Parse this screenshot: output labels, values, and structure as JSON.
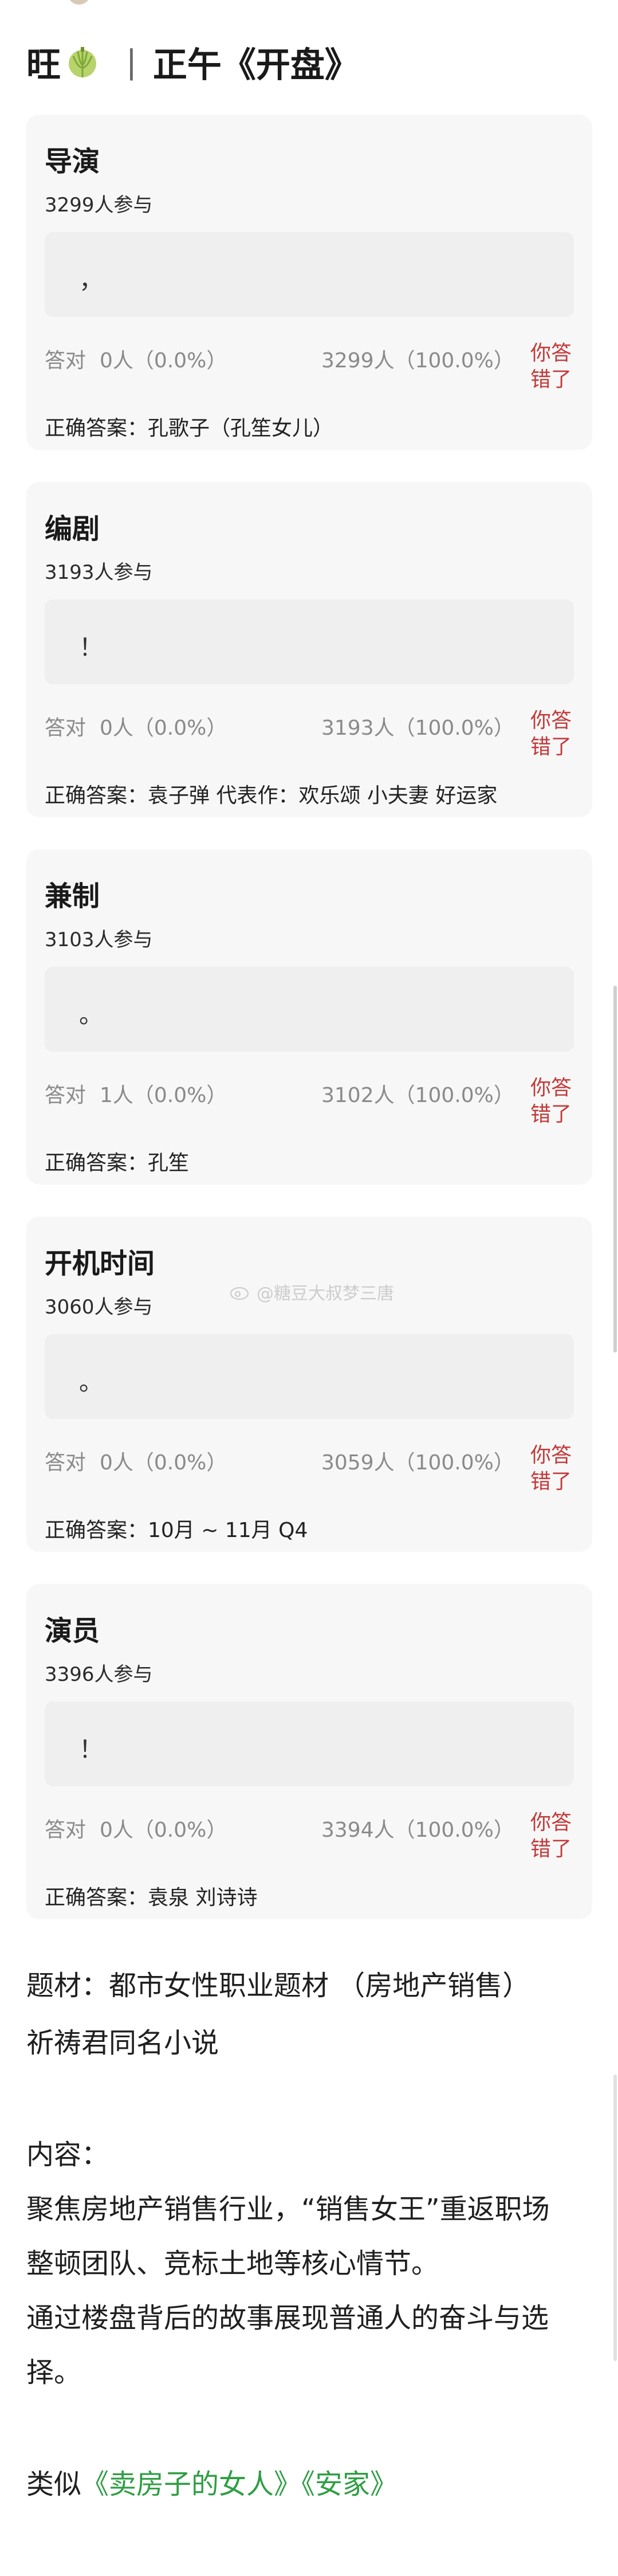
{
  "header": {
    "left": "旺",
    "separator": "|",
    "title": "正午《开盘》"
  },
  "questions": [
    {
      "title": "导演",
      "participants": "3299人参与",
      "answer": "，",
      "stat_label": "答对",
      "correct_count": "0人（0.0%）",
      "wrong_count": "3299人（100.0%）",
      "result": "你答错了",
      "correct_answer": "正确答案：孔歌子（孔笙女儿）"
    },
    {
      "title": "编剧",
      "participants": "3193人参与",
      "answer": "！",
      "stat_label": "答对",
      "correct_count": "0人（0.0%）",
      "wrong_count": "3193人（100.0%）",
      "result": "你答错了",
      "correct_answer": "正确答案：袁子弹 代表作：欢乐颂 小夫妻 好运家"
    },
    {
      "title": "兼制",
      "participants": "3103人参与",
      "answer": "。",
      "stat_label": "答对",
      "correct_count": "1人（0.0%）",
      "wrong_count": "3102人（100.0%）",
      "result": "你答错了",
      "correct_answer": "正确答案：孔笙"
    },
    {
      "title": "开机时间",
      "participants": "3060人参与",
      "answer": "。",
      "stat_label": "答对",
      "correct_count": "0人（0.0%）",
      "wrong_count": "3059人（100.0%）",
      "result": "你答错了",
      "correct_answer": "正确答案：10月 ~ 11月 Q4"
    },
    {
      "title": "演员",
      "participants": "3396人参与",
      "answer": "！",
      "stat_label": "答对",
      "correct_count": "0人（0.0%）",
      "wrong_count": "3394人（100.0%）",
      "result": "你答错了",
      "correct_answer": "正确答案：袁泉 刘诗诗"
    }
  ],
  "watermark": "@糖豆大叔梦三唐",
  "body": {
    "line1": "题材：都市女性职业题材 （房地产销售）",
    "line2": "祈祷君同名小说",
    "line3": "内容：",
    "line4": "聚焦房地产销售行业，“销售女王”重返职场",
    "line5": "整顿团队、竞标土地等核心情节。",
    "line6": "通过楼盘背后的故事展现普通人的奋斗与选",
    "line7": "择。",
    "similar_prefix": "类似",
    "similar_link1": "《卖房子的女人》",
    "similar_link2": "《安家》"
  },
  "colors": {
    "card_bg": "#f7f7f7",
    "wrong_red": "#c33a3a",
    "link_green": "#2f9e44"
  }
}
